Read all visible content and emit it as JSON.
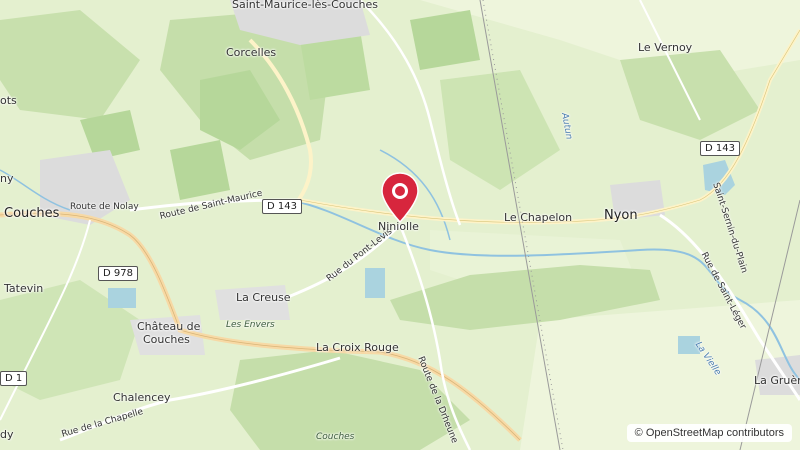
{
  "map": {
    "attribution": {
      "symbol": "©",
      "text": "OpenStreetMap contributors"
    },
    "marker": {
      "label": "Niniolle",
      "color": "#d7263d",
      "icon": "map-pin-icon"
    },
    "places": {
      "top": "Saint-Maurice-lès-Couches",
      "corcelles": "Corcelles",
      "levernoy": "Le Vernoy",
      "couches": "Couches",
      "nyon": "Nyon",
      "lachapelon": "Le Chapelon",
      "lacreuse": "La Creuse",
      "chateau_l1": "Château de",
      "chateau_l2": "Couches",
      "lacroixrouge": "La Croix Rouge",
      "chalencey": "Chalencey",
      "tatevin": "Tatevin",
      "lagruere": "La Gruère",
      "ots": "ots",
      "ny": "ny",
      "dy": "dy"
    },
    "roads": {
      "d143_shield_1": "D 143",
      "d143_shield_2": "D 143",
      "d978_shield": "D 978",
      "d1_shield": "D 1",
      "route_de_nolay": "Route de Nolay",
      "route_de_saint_maurice": "Route de Saint-Maurice",
      "rue_du_pont_levis": "Rue du Pont-Levis",
      "route_de_la_drheune": "Route de la Drheune",
      "rue_de_saint_leger": "Rue de Saint-Léger",
      "route_de_saint_sernin": "Saint-Sernin-du-Plain",
      "rue_de_la_chapelle": "Rue de la Chapelle"
    },
    "water": {
      "autun": "Autun",
      "la_vielle": "La Vielle"
    },
    "localities": {
      "les_envers": "Les Envers",
      "couches_bottom": "Couches"
    },
    "colors": {
      "background": "#e4f0cf",
      "forest": "#c5deaa",
      "vineyard": "#b6d79a",
      "urban": "#dcdcdc",
      "water": "#aad3df",
      "road_major": "#f7d9a5",
      "road_minor": "#ffffff"
    }
  }
}
